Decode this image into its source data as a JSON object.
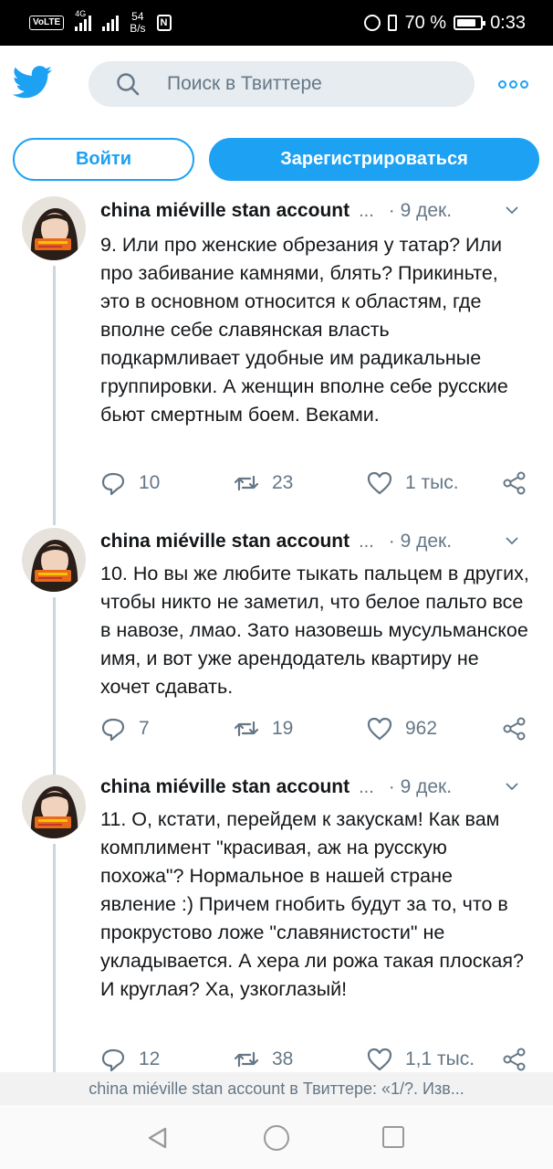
{
  "status_bar": {
    "volte": "VoLTE",
    "network": "4G",
    "speed_value": "54",
    "speed_unit": "B/s",
    "nfc": "N",
    "battery_percent": "70 %",
    "battery_level": 0.7,
    "time": "0:33"
  },
  "header": {
    "search_placeholder": "Поиск в Твиттере",
    "login_label": "Войти",
    "signup_label": "Зарегистрироваться",
    "accent_color": "#1da1f2"
  },
  "tweets": [
    {
      "author": "china miéville stan account",
      "ellipsis": "...",
      "date": "· 9 дек.",
      "text": "9. Или про женские обрезания у татар? Или про забивание камнями, блять? Прикиньте, это в основном относится к областям, где вполне себе славянская власть подкармливает удобные им радикальные группировки. А женщин вполне себе русские бьют смертным боем. Веками.",
      "replies": "10",
      "retweets": "23",
      "likes": "1 тыс."
    },
    {
      "author": "china miéville stan account",
      "ellipsis": "...",
      "date": "· 9 дек.",
      "text": "10. Но вы же любите тыкать пальцем в других, чтобы никто не заметил, что белое пальто все в навозе, лмао. Зато назовешь мусульманское имя, и вот уже арендодатель квартиру не хочет сдавать.",
      "replies": "7",
      "retweets": "19",
      "likes": "962"
    },
    {
      "author": "china miéville stan account",
      "ellipsis": "...",
      "date": "· 9 дек.",
      "text": "11. О, кстати, перейдем к закускам! Как вам комплимент \"красивая, аж на русскую похожа\"? Нормальное в нашей стране явление :) Причем гнобить будут за то, что в прокрустово ложе \"славянистости\" не укладывается. А хера ли рожа такая плоская? И круглая? Ха, узкоглазый!",
      "replies": "12",
      "retweets": "38",
      "likes": "1,1 тыс."
    }
  ],
  "page_title": "china miéville stan account в Твиттере: «1/?. Изв..."
}
